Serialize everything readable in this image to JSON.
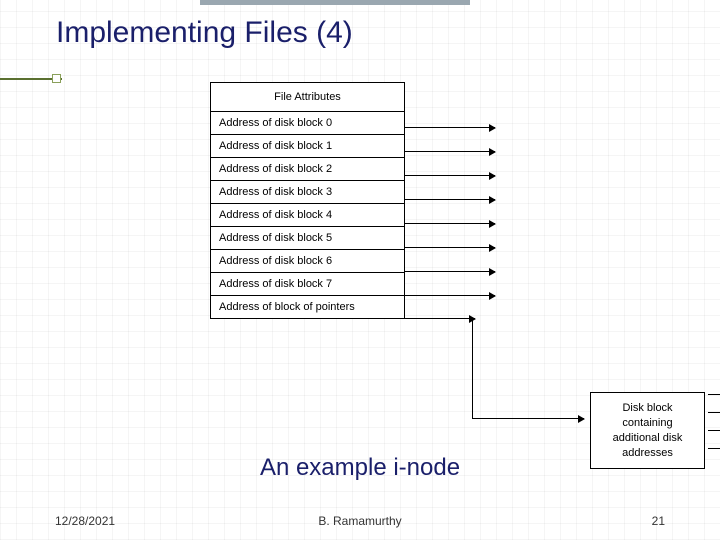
{
  "title": "Implementing Files (4)",
  "inode": {
    "attributes_label": "File Attributes",
    "rows": [
      "Address of disk block 0",
      "Address of disk block 1",
      "Address of disk block 2",
      "Address of disk block 3",
      "Address of disk block 4",
      "Address of disk block 5",
      "Address of disk block 6",
      "Address of disk block 7",
      "Address of block of pointers"
    ]
  },
  "disk_block_label": "Disk block containing additional disk addresses",
  "caption": "An example i-node",
  "footer": {
    "date": "12/28/2021",
    "author": "B. Ramamurthy",
    "page": "21"
  },
  "colors": {
    "title": "#1a1f6a",
    "accent": "#5a7030"
  }
}
